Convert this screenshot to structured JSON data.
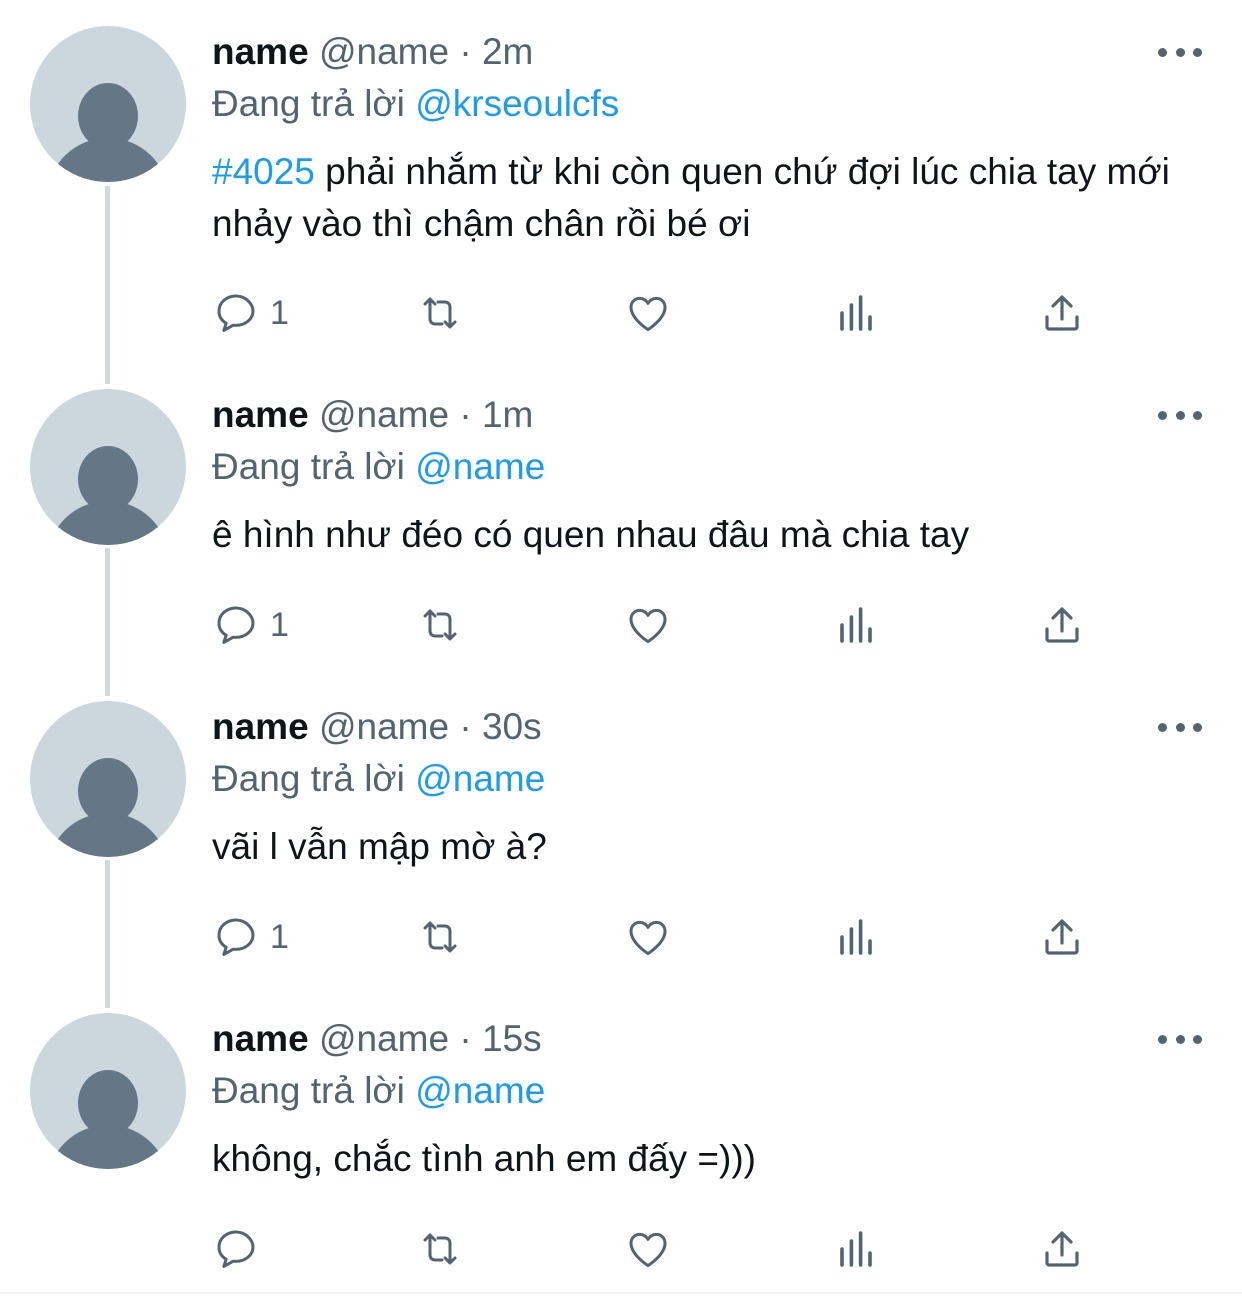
{
  "colors": {
    "link": "#1d9bf0",
    "muted": "#536471",
    "text": "#0f1419",
    "avatar_bg": "#ccd6dd",
    "avatar_fg": "#657786",
    "thread_line": "#cfd9de"
  },
  "replying_prefix": "Đang trả lời",
  "tweets": [
    {
      "display_name": "name",
      "handle": "@name",
      "separator": "·",
      "time": "2m",
      "replying_to": "@krseoulcfs",
      "hashtag": "#4025",
      "text": " phải nhắm từ khi còn quen chứ đợi lúc chia tay mới nhảy vào thì chậm chân rồi bé ơi",
      "reply_count": "1",
      "icons": [
        "reply-icon",
        "retweet-icon",
        "like-icon",
        "stats-icon",
        "share-icon"
      ]
    },
    {
      "display_name": "name",
      "handle": "@name",
      "separator": "·",
      "time": "1m",
      "replying_to": "@name",
      "text": "ê hình như đéo có quen nhau đâu mà chia tay",
      "reply_count": "1"
    },
    {
      "display_name": "name",
      "handle": "@name",
      "separator": "·",
      "time": "30s",
      "replying_to": "@name",
      "text": "vãi l vẫn mập mờ à?",
      "reply_count": "1"
    },
    {
      "display_name": "name",
      "handle": "@name",
      "separator": "·",
      "time": "15s",
      "replying_to": "@name",
      "text": "không, chắc tình anh em đấy =)))",
      "reply_count": ""
    }
  ]
}
